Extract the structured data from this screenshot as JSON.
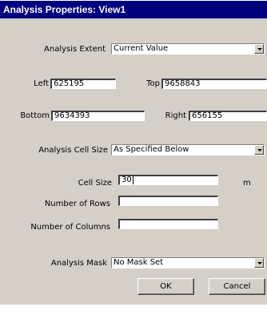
{
  "window": {
    "title": "Analysis Properties: View1"
  },
  "extent": {
    "label": "Analysis Extent",
    "value": "Current Value"
  },
  "left": {
    "label": "Left",
    "value": "625195"
  },
  "top": {
    "label": "Top",
    "value": "9658843"
  },
  "bottom": {
    "label": "Bottom",
    "value": "9634393"
  },
  "right": {
    "label": "Right",
    "value": "656155"
  },
  "cell_size_mode": {
    "label": "Analysis Cell Size",
    "value": "As Specified Below"
  },
  "cell_size": {
    "label": "Cell Size",
    "value": "30",
    "unit": "m"
  },
  "rows": {
    "label": "Number of Rows",
    "value": ""
  },
  "columns": {
    "label": "Number of Columns",
    "value": ""
  },
  "mask": {
    "label": "Analysis Mask",
    "value": "No Mask Set"
  },
  "buttons": {
    "ok": "OK",
    "cancel": "Cancel"
  }
}
